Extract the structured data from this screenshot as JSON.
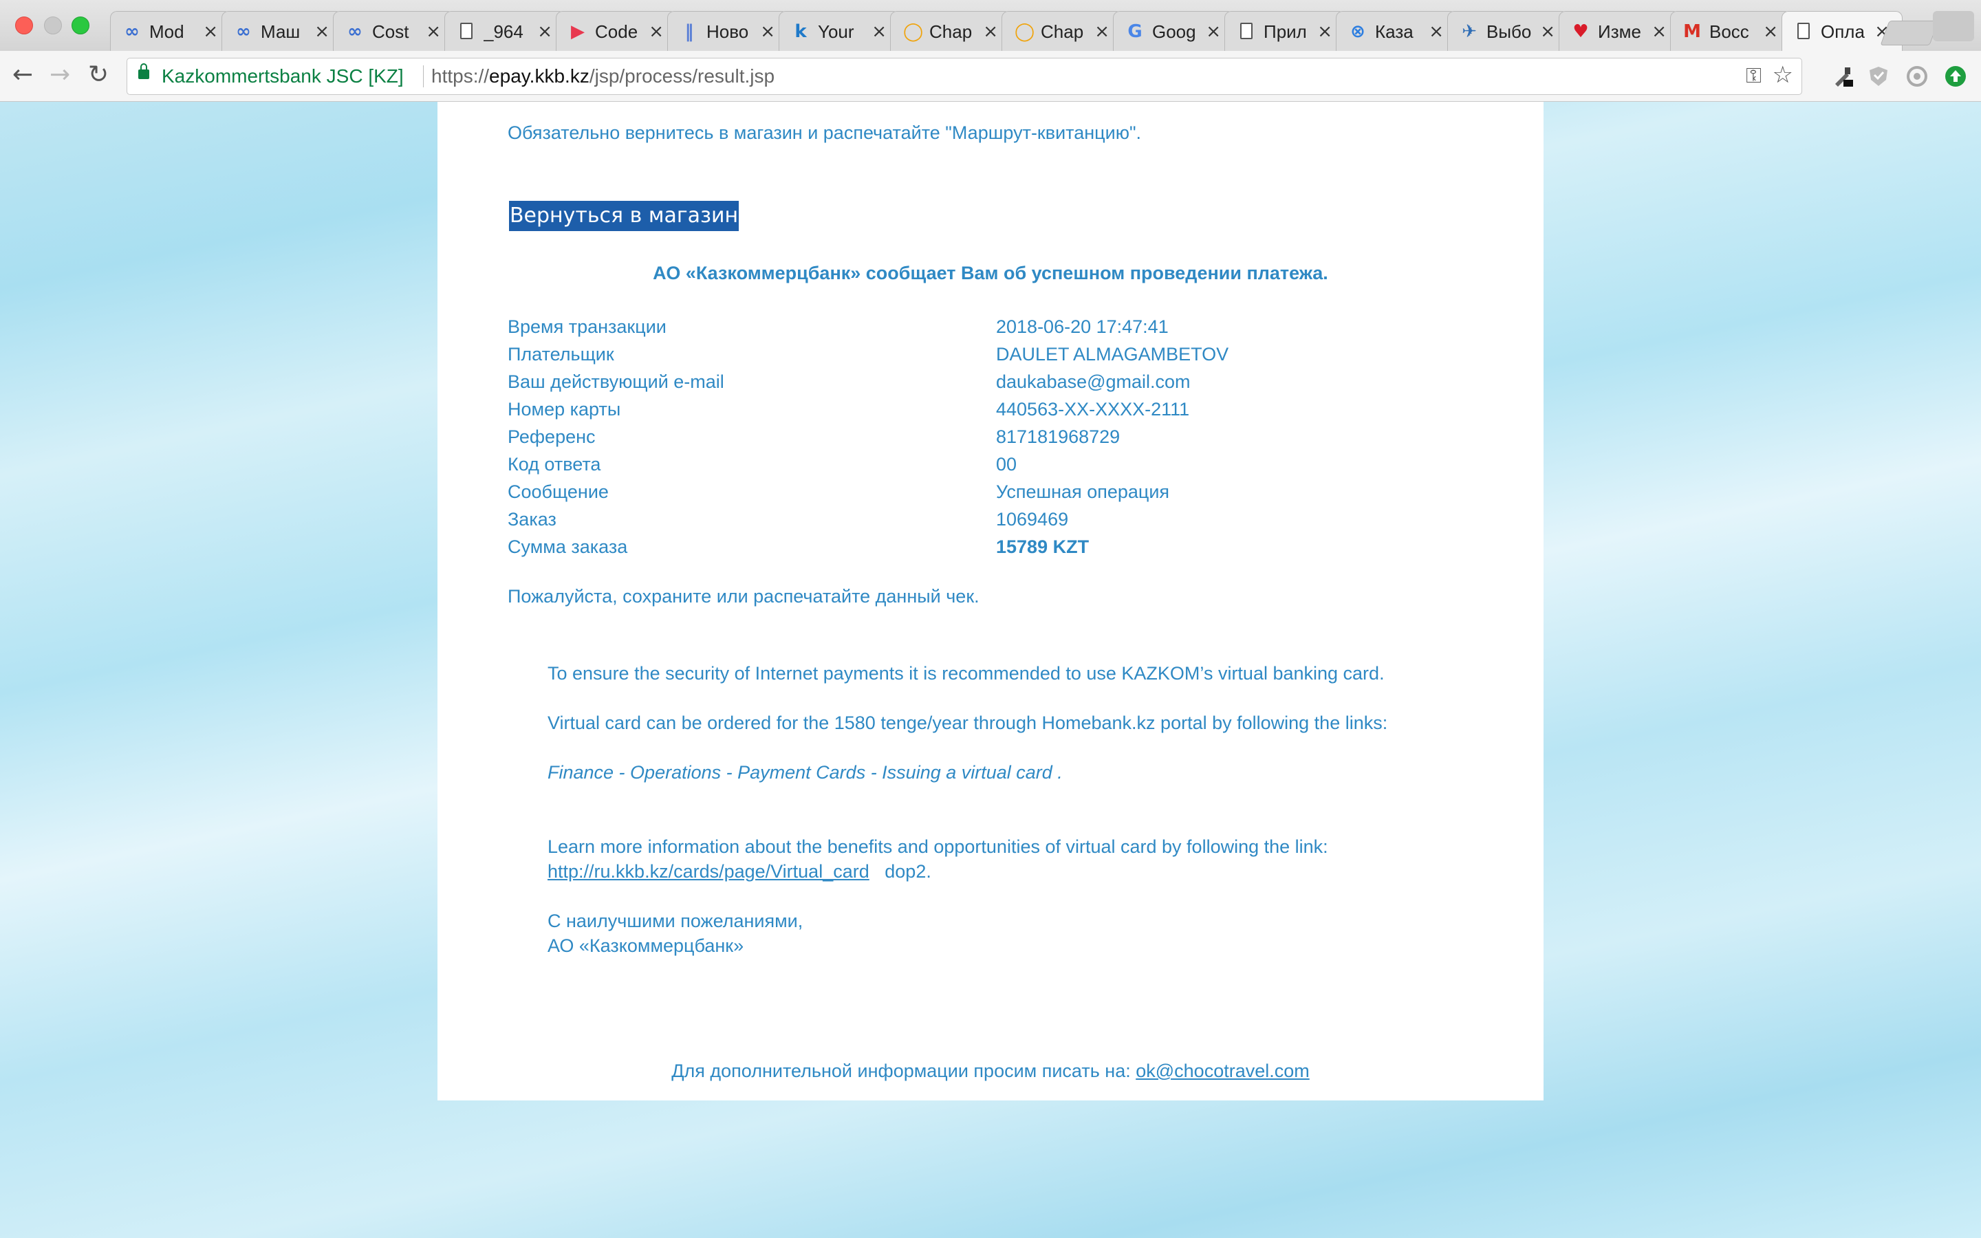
{
  "browser": {
    "tabs": [
      {
        "label": "Mod",
        "icon": "infinity-icon",
        "color": "#3b6fd1"
      },
      {
        "label": "Маш",
        "icon": "infinity-icon",
        "color": "#3b6fd1"
      },
      {
        "label": "Cost",
        "icon": "infinity-icon",
        "color": "#3b6fd1"
      },
      {
        "label": "_964",
        "icon": "page-icon",
        "color": "#555555"
      },
      {
        "label": "Code",
        "icon": "play-icon",
        "color": "#e8384f"
      },
      {
        "label": "Ново",
        "icon": "pause-icon",
        "color": "#5a7fd6"
      },
      {
        "label": "Your",
        "icon": "k-icon",
        "color": "#1f7ac9"
      },
      {
        "label": "Chap",
        "icon": "ring-icon",
        "color": "#f0a30a"
      },
      {
        "label": "Chap",
        "icon": "ring-icon",
        "color": "#f0a30a"
      },
      {
        "label": "Goog",
        "icon": "translate-icon",
        "color": "#4a86e8"
      },
      {
        "label": "Прил",
        "icon": "page-icon",
        "color": "#555555"
      },
      {
        "label": "Каза",
        "icon": "globe-icon",
        "color": "#2d7ee0"
      },
      {
        "label": "Выбо",
        "icon": "plane-icon",
        "color": "#2f6db5"
      },
      {
        "label": "Изме",
        "icon": "heart-icon",
        "color": "#d91c2a"
      },
      {
        "label": "Восс",
        "icon": "gmail-icon",
        "color": "#d93025"
      },
      {
        "label": "Опла",
        "icon": "page-icon",
        "color": "#555555",
        "active": true
      }
    ],
    "close_glyph": "×",
    "security_label": "Kazkommertsbank JSC [KZ]",
    "url_scheme": "https://",
    "url_domain": "epay.kkb.kz",
    "url_path": "/jsp/process/result.jsp"
  },
  "page": {
    "top_notice": "Обязательно вернитесь в магазин и распечатайте \"Маршрут-квитанцию\".",
    "return_button": "Вернуться в магазин",
    "success_message": "АО «Казкоммерцбанк» сообщает Вам об успешном проведении платежа.",
    "details": [
      {
        "label": "Время транзакции",
        "value": "2018-06-20 17:47:41"
      },
      {
        "label": "Плательщик",
        "value": "DAULET ALMAGAMBETOV"
      },
      {
        "label": "Ваш действующий e-mail",
        "value": "daukabase@gmail.com"
      },
      {
        "label": "Номер карты",
        "value": "440563-XX-XXXX-2111"
      },
      {
        "label": "Референс",
        "value": "817181968729"
      },
      {
        "label": "Код ответа",
        "value": "00"
      },
      {
        "label": "Сообщение",
        "value": "Успешная операция"
      },
      {
        "label": "Заказ",
        "value": "1069469"
      },
      {
        "label": "Сумма заказа",
        "value": "15789 KZT",
        "bold": true
      }
    ],
    "save_note": "Пожалуйста, сохраните или распечатайте данный чек.",
    "security_text": "To ensure the security of Internet payments it is recommended to use KAZKOM’s virtual banking card.",
    "virtual_card_text": "Virtual card can be ordered for the 1580 tenge/year through Homebank.kz portal by following the links:",
    "path_text": "Finance - Operations - Payment Cards - Issuing a virtual card .",
    "learn_more": "Learn more information about the benefits and opportunities of virtual card by following the link:",
    "learn_link": "http://ru.kkb.kz/cards/page/Virtual_card",
    "learn_suffix": "dop2.",
    "regards_1": "С наилучшими пожеланиями,",
    "regards_2": "АО «Казкоммерцбанк»",
    "footer_text": "Для дополнительной информации просим писать на: ",
    "footer_email": "ok@chocotravel.com"
  }
}
